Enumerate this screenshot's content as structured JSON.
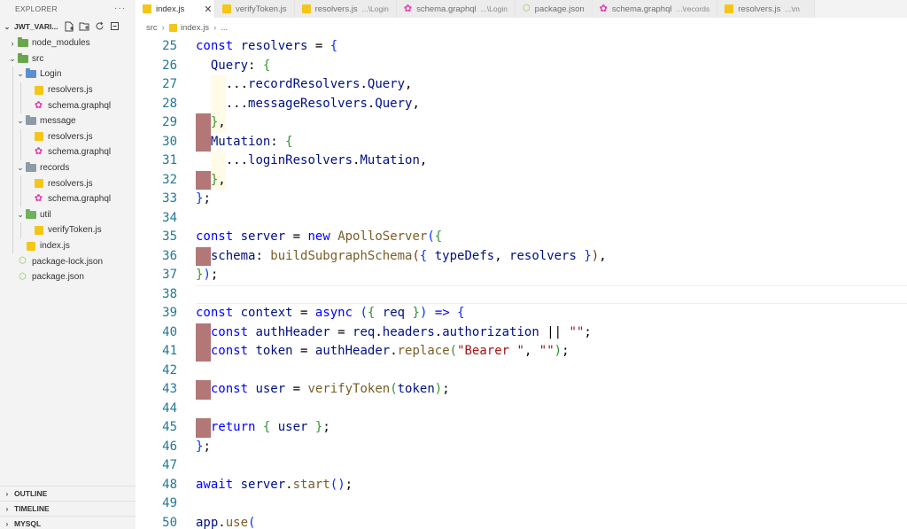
{
  "explorer": {
    "title": "EXPLORER",
    "more": "···",
    "project": "JWT_VARI...",
    "tree": [
      {
        "label": "node_modules",
        "type": "folder-green"
      },
      {
        "label": "src",
        "type": "folder-green"
      },
      {
        "label": "Login",
        "type": "folder-blue"
      },
      {
        "label": "resolvers.js",
        "type": "js"
      },
      {
        "label": "schema.graphql",
        "type": "graphql"
      },
      {
        "label": "message",
        "type": "folder-grey"
      },
      {
        "label": "resolvers.js",
        "type": "js"
      },
      {
        "label": "schema.graphql",
        "type": "graphql"
      },
      {
        "label": "records",
        "type": "folder-grey"
      },
      {
        "label": "resolvers.js",
        "type": "js"
      },
      {
        "label": "schema.graphql",
        "type": "graphql"
      },
      {
        "label": "util",
        "type": "folder-util"
      },
      {
        "label": "verifyToken.js",
        "type": "js"
      },
      {
        "label": "index.js",
        "type": "js"
      },
      {
        "label": "package-lock.json",
        "type": "json"
      },
      {
        "label": "package.json",
        "type": "json"
      }
    ],
    "panels": [
      "OUTLINE",
      "TIMELINE",
      "MYSQL"
    ]
  },
  "tabs": [
    {
      "label": "index.js",
      "sub": "",
      "icon": "js",
      "active": true
    },
    {
      "label": "verifyToken.js",
      "sub": "",
      "icon": "js",
      "active": false
    },
    {
      "label": "resolvers.js",
      "sub": "...\\Login",
      "icon": "js",
      "active": false
    },
    {
      "label": "schema.graphql",
      "sub": "...\\Login",
      "icon": "graphql",
      "active": false
    },
    {
      "label": "package.json",
      "sub": "",
      "icon": "json",
      "active": false
    },
    {
      "label": "schema.graphql",
      "sub": "...\\records",
      "icon": "graphql",
      "active": false
    },
    {
      "label": "resolvers.js",
      "sub": "...\\m",
      "icon": "js",
      "active": false
    }
  ],
  "breadcrumb": {
    "folder": "src",
    "file": "index.js",
    "rest": "..."
  },
  "editor": {
    "lines": [
      {
        "n": "25",
        "segs": [
          [
            "kw",
            "const"
          ],
          [
            "",
            ""
          ],
          [
            "prop",
            " resolvers"
          ],
          [
            "",
            " = "
          ],
          [
            "br1",
            "{"
          ]
        ]
      },
      {
        "n": "26",
        "segs": [
          [
            "",
            "  "
          ],
          [
            "prop",
            "Query"
          ],
          [
            ":",
            " "
          ],
          [
            "br2",
            "{"
          ]
        ]
      },
      {
        "n": "27",
        "segs": [
          [
            "",
            "    ..."
          ],
          [
            "prop",
            "recordResolvers"
          ],
          [
            "",
            "."
          ],
          [
            "prop",
            "Query"
          ],
          [
            "",
            ","
          ]
        ]
      },
      {
        "n": "28",
        "segs": [
          [
            "",
            "    ..."
          ],
          [
            "prop",
            "messageResolvers"
          ],
          [
            "",
            "."
          ],
          [
            "prop",
            "Query"
          ],
          [
            "",
            ","
          ]
        ]
      },
      {
        "n": "29",
        "segs": [
          [
            "",
            "  "
          ],
          [
            "br2",
            "}"
          ],
          [
            "",
            ","
          ]
        ]
      },
      {
        "n": "30",
        "segs": [
          [
            "",
            "  "
          ],
          [
            "prop",
            "Mutation"
          ],
          [
            "",
            ": "
          ],
          [
            "br2",
            "{"
          ]
        ]
      },
      {
        "n": "31",
        "segs": [
          [
            "",
            "    ..."
          ],
          [
            "prop",
            "loginResolvers"
          ],
          [
            "",
            "."
          ],
          [
            "prop",
            "Mutation"
          ],
          [
            "",
            ","
          ]
        ]
      },
      {
        "n": "32",
        "segs": [
          [
            "",
            "  "
          ],
          [
            "br2",
            "}"
          ],
          [
            "",
            ","
          ]
        ]
      },
      {
        "n": "33",
        "segs": [
          [
            "br1",
            "}"
          ],
          [
            "",
            ";"
          ]
        ]
      },
      {
        "n": "34",
        "segs": []
      },
      {
        "n": "35",
        "segs": [
          [
            "kw",
            "const"
          ],
          [
            "prop",
            " server"
          ],
          [
            "",
            " = "
          ],
          [
            "kw",
            "new"
          ],
          [
            "fn",
            " ApolloServer"
          ],
          [
            "br1",
            "("
          ],
          [
            "br2",
            "{"
          ]
        ]
      },
      {
        "n": "36",
        "segs": [
          [
            "",
            "  "
          ],
          [
            "prop",
            "schema"
          ],
          [
            "",
            ": "
          ],
          [
            "fn",
            "buildSubgraphSchema"
          ],
          [
            "br3",
            "("
          ],
          [
            "br1",
            "{"
          ],
          [
            "prop",
            " typeDefs"
          ],
          [
            "",
            ", "
          ],
          [
            "prop",
            "resolvers"
          ],
          [
            "br1",
            " }"
          ],
          [
            "br3",
            ")"
          ],
          [
            "",
            ","
          ]
        ]
      },
      {
        "n": "37",
        "segs": [
          [
            "br2",
            "}"
          ],
          [
            "br1",
            ")"
          ],
          [
            "",
            ";"
          ]
        ]
      },
      {
        "n": "38",
        "segs": []
      },
      {
        "n": "39",
        "segs": [
          [
            "kw",
            "const"
          ],
          [
            "prop",
            " context"
          ],
          [
            "",
            " = "
          ],
          [
            "kw",
            "async"
          ],
          [
            "",
            " "
          ],
          [
            "br1",
            "("
          ],
          [
            "br2",
            "{"
          ],
          [
            "prop",
            " req"
          ],
          [
            "br2",
            " }"
          ],
          [
            "br1",
            ")"
          ],
          [
            "",
            " "
          ],
          [
            "kw",
            "=>"
          ],
          [
            "",
            " "
          ],
          [
            "br1",
            "{"
          ]
        ]
      },
      {
        "n": "40",
        "segs": [
          [
            "",
            "  "
          ],
          [
            "kw",
            "const"
          ],
          [
            "prop",
            " authHeader"
          ],
          [
            "",
            " = "
          ],
          [
            "prop",
            "req"
          ],
          [
            "",
            "."
          ],
          [
            "prop",
            "headers"
          ],
          [
            "",
            "."
          ],
          [
            "prop",
            "authorization"
          ],
          [
            "",
            " || "
          ],
          [
            "str",
            "\"\""
          ],
          [
            "",
            ";"
          ]
        ]
      },
      {
        "n": "41",
        "segs": [
          [
            "",
            "  "
          ],
          [
            "kw",
            "const"
          ],
          [
            "prop",
            " token"
          ],
          [
            "",
            " = "
          ],
          [
            "prop",
            "authHeader"
          ],
          [
            "",
            "."
          ],
          [
            "fn",
            "replace"
          ],
          [
            "br2",
            "("
          ],
          [
            "str",
            "\"Bearer \""
          ],
          [
            "",
            ", "
          ],
          [
            "str",
            "\"\""
          ],
          [
            "br2",
            ")"
          ],
          [
            "",
            ";"
          ]
        ]
      },
      {
        "n": "42",
        "segs": []
      },
      {
        "n": "43",
        "segs": [
          [
            "",
            "  "
          ],
          [
            "kw",
            "const"
          ],
          [
            "prop",
            " user"
          ],
          [
            "",
            " = "
          ],
          [
            "fn",
            "verifyToken"
          ],
          [
            "br2",
            "("
          ],
          [
            "prop",
            "token"
          ],
          [
            "br2",
            ")"
          ],
          [
            "",
            ";"
          ]
        ]
      },
      {
        "n": "44",
        "segs": []
      },
      {
        "n": "45",
        "segs": [
          [
            "",
            "  "
          ],
          [
            "kw",
            "return"
          ],
          [
            "",
            " "
          ],
          [
            "br2",
            "{"
          ],
          [
            "prop",
            " user"
          ],
          [
            "br2",
            " }"
          ],
          [
            "",
            ";"
          ]
        ]
      },
      {
        "n": "46",
        "segs": [
          [
            "br1",
            "}"
          ],
          [
            "",
            ";"
          ]
        ]
      },
      {
        "n": "47",
        "segs": []
      },
      {
        "n": "48",
        "segs": [
          [
            "kw",
            "await"
          ],
          [
            "prop",
            " server"
          ],
          [
            "",
            "."
          ],
          [
            "fn",
            "start"
          ],
          [
            "br1",
            "()"
          ],
          [
            "",
            ";"
          ]
        ]
      },
      {
        "n": "49",
        "segs": []
      },
      {
        "n": "50",
        "segs": [
          [
            "prop",
            "app"
          ],
          [
            "",
            "."
          ],
          [
            "fn",
            "use"
          ],
          [
            "br1",
            "("
          ]
        ]
      }
    ]
  }
}
